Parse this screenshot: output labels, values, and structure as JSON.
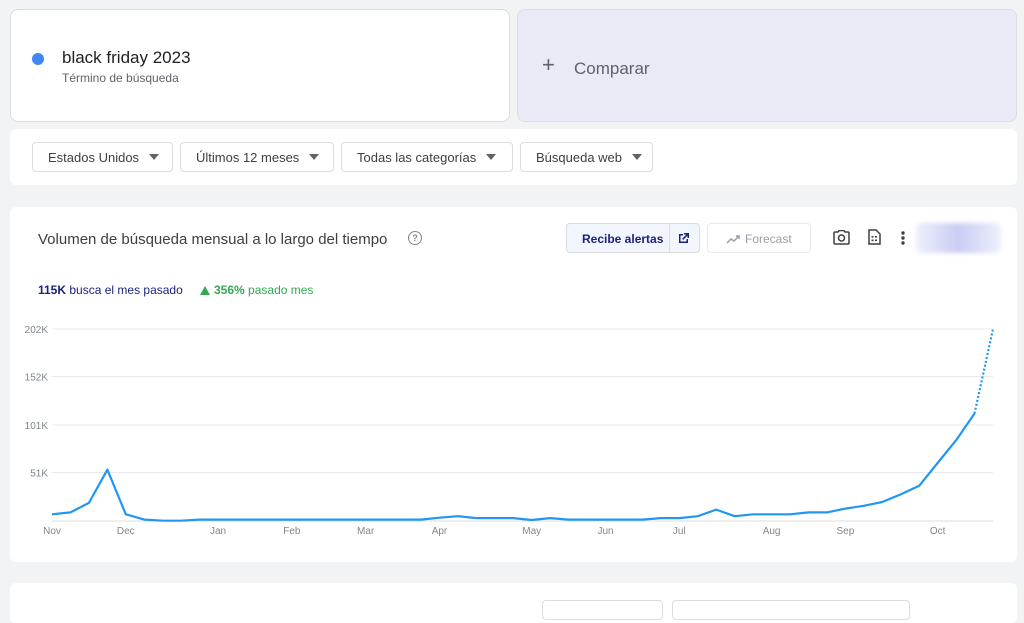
{
  "term": {
    "name": "black friday 2023",
    "type": "Término de búsqueda",
    "color": "#4285f4"
  },
  "compare": {
    "label": "Comparar"
  },
  "filters": [
    {
      "label": "Estados Unidos"
    },
    {
      "label": "Últimos 12 meses"
    },
    {
      "label": "Todas las categorías"
    },
    {
      "label": "Búsqueda web"
    }
  ],
  "chart_panel": {
    "title": "Volumen de búsqueda mensual a lo largo del tiempo",
    "alerts_label": "Recibe alertas",
    "forecast_label": "Forecast",
    "stat_value": "115K",
    "stat_text": "busca el mes pasado",
    "change_value": "356%",
    "change_text": "pasado mes"
  },
  "icons": {
    "help": "help-circle-icon",
    "external": "external-link-icon",
    "forecast": "trending-up-icon",
    "camera": "camera-icon",
    "csv": "csv-file-icon",
    "more": "more-vert-icon"
  },
  "chart_data": {
    "type": "line",
    "title": "",
    "xlabel": "",
    "ylabel": "",
    "ytick_labels": [
      "51K",
      "101K",
      "152K",
      "202K"
    ],
    "ytick_values": [
      51000,
      101000,
      152000,
      202000
    ],
    "ylim": [
      0,
      202000
    ],
    "x_tick_labels": [
      "Nov",
      "Dec",
      "Jan",
      "Feb",
      "Mar",
      "Apr",
      "May",
      "Jun",
      "Jul",
      "Aug",
      "Sep",
      "Oct"
    ],
    "x_tick_weeks": [
      0,
      4,
      9,
      13,
      17,
      21,
      26,
      30,
      34,
      39,
      43,
      48
    ],
    "grid": true,
    "line_color": "#2196f3",
    "series": [
      {
        "values": [
          7000,
          9000,
          19000,
          54000,
          7000,
          1500,
          300,
          300,
          1500,
          1500,
          1500,
          1500,
          1500,
          1500,
          1500,
          1500,
          1500,
          1500,
          1500,
          1500,
          1500,
          3500,
          5000,
          3000,
          3000,
          3000,
          1000,
          3000,
          1500,
          1500,
          1500,
          1500,
          1500,
          3000,
          3000,
          5000,
          12000,
          5000,
          7000,
          7000,
          7000,
          9000,
          9000,
          13000,
          16000,
          20000,
          28000,
          37000,
          61000,
          85000,
          113000
        ],
        "forecast": [
          113000,
          202000
        ]
      }
    ],
    "xlim_weeks": [
      0,
      51
    ]
  }
}
